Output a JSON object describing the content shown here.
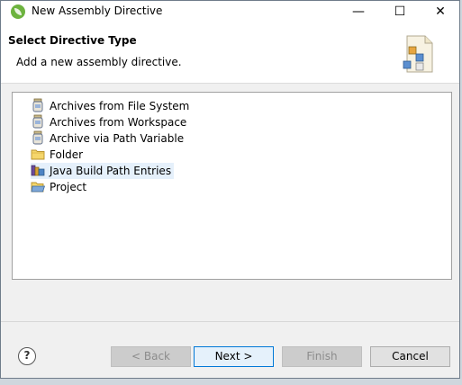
{
  "window": {
    "title": "New Assembly Directive",
    "minimize_glyph": "—",
    "maximize_glyph": "☐",
    "close_glyph": "✕"
  },
  "header": {
    "title": "Select Directive Type",
    "description": "Add a new assembly directive."
  },
  "tree": {
    "items": [
      {
        "label": "Archives from File System",
        "icon": "jar-icon"
      },
      {
        "label": "Archives from Workspace",
        "icon": "jar-icon"
      },
      {
        "label": "Archive via Path Variable",
        "icon": "jar-icon"
      },
      {
        "label": "Folder",
        "icon": "folder-icon"
      },
      {
        "label": "Java Build Path Entries",
        "icon": "library-icon",
        "selected": true
      },
      {
        "label": "Project",
        "icon": "project-folder-icon"
      }
    ]
  },
  "buttons": {
    "help": "?",
    "back": "< Back",
    "next": "Next >",
    "finish": "Finish",
    "cancel": "Cancel"
  },
  "colors": {
    "selection": "#e5f0fb",
    "default_button_border": "#0078d7",
    "spring_green": "#6db33f"
  }
}
